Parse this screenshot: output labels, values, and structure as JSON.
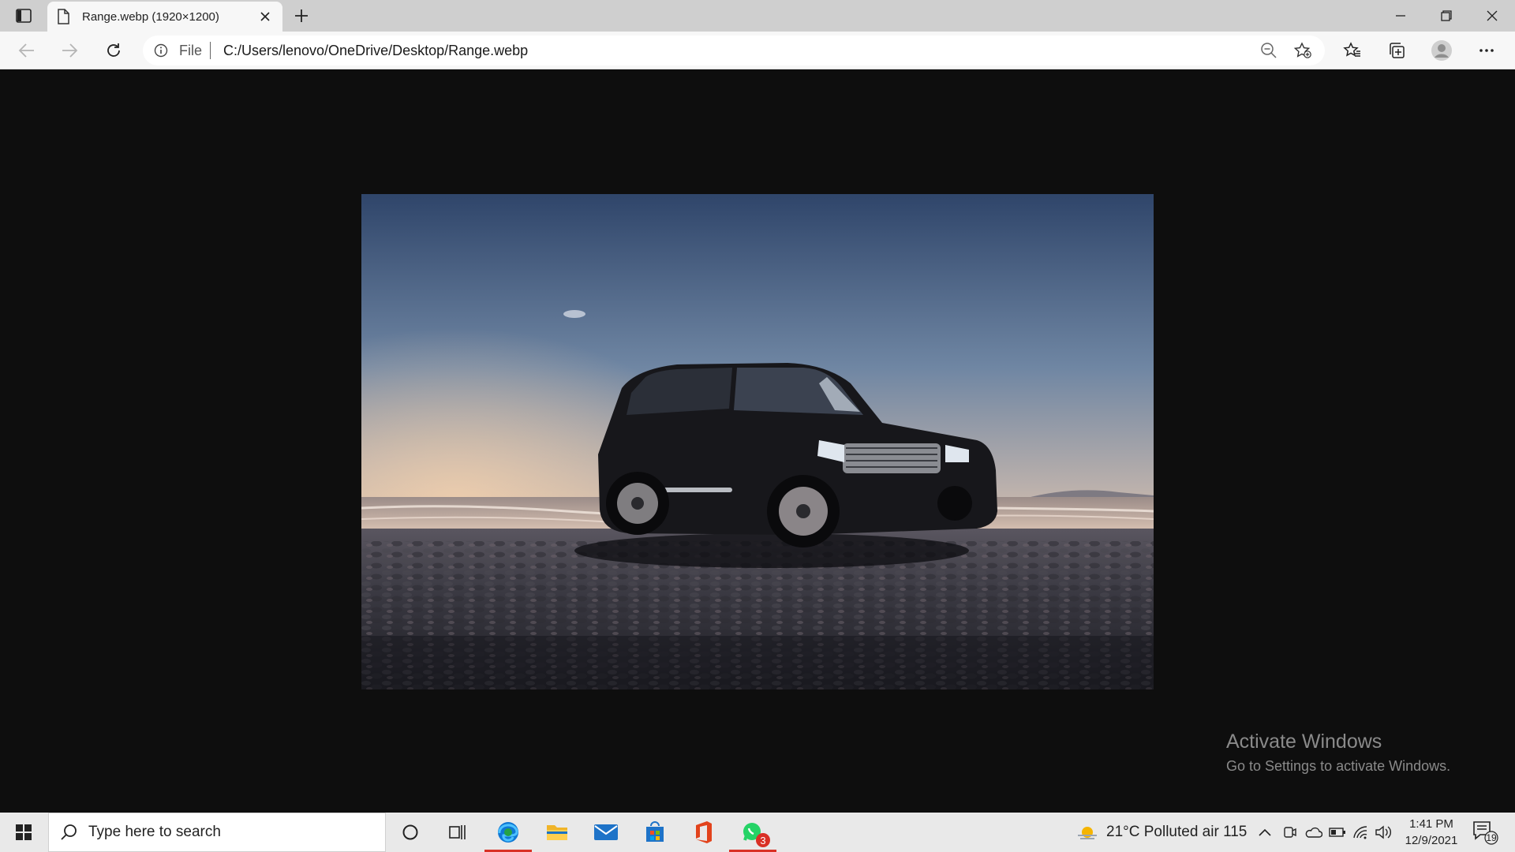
{
  "browser": {
    "tab_title": "Range.webp (1920×1200)",
    "omnibox": {
      "scheme_label": "File",
      "url": "C:/Users/lenovo/OneDrive/Desktop/Range.webp"
    }
  },
  "watermark": {
    "heading": "Activate Windows",
    "subtext": "Go to Settings to activate Windows."
  },
  "taskbar": {
    "search_placeholder": "Type here to search",
    "whatsapp_badge": "3",
    "weather_text": "21°C  Polluted air 115",
    "clock_time": "1:41 PM",
    "clock_date": "12/9/2021",
    "notification_count": "19"
  },
  "colors": {
    "taskbar_active_indicator": "#d93025",
    "viewer_background": "#0e0e0e",
    "edge_blue": "#0f78d4"
  }
}
